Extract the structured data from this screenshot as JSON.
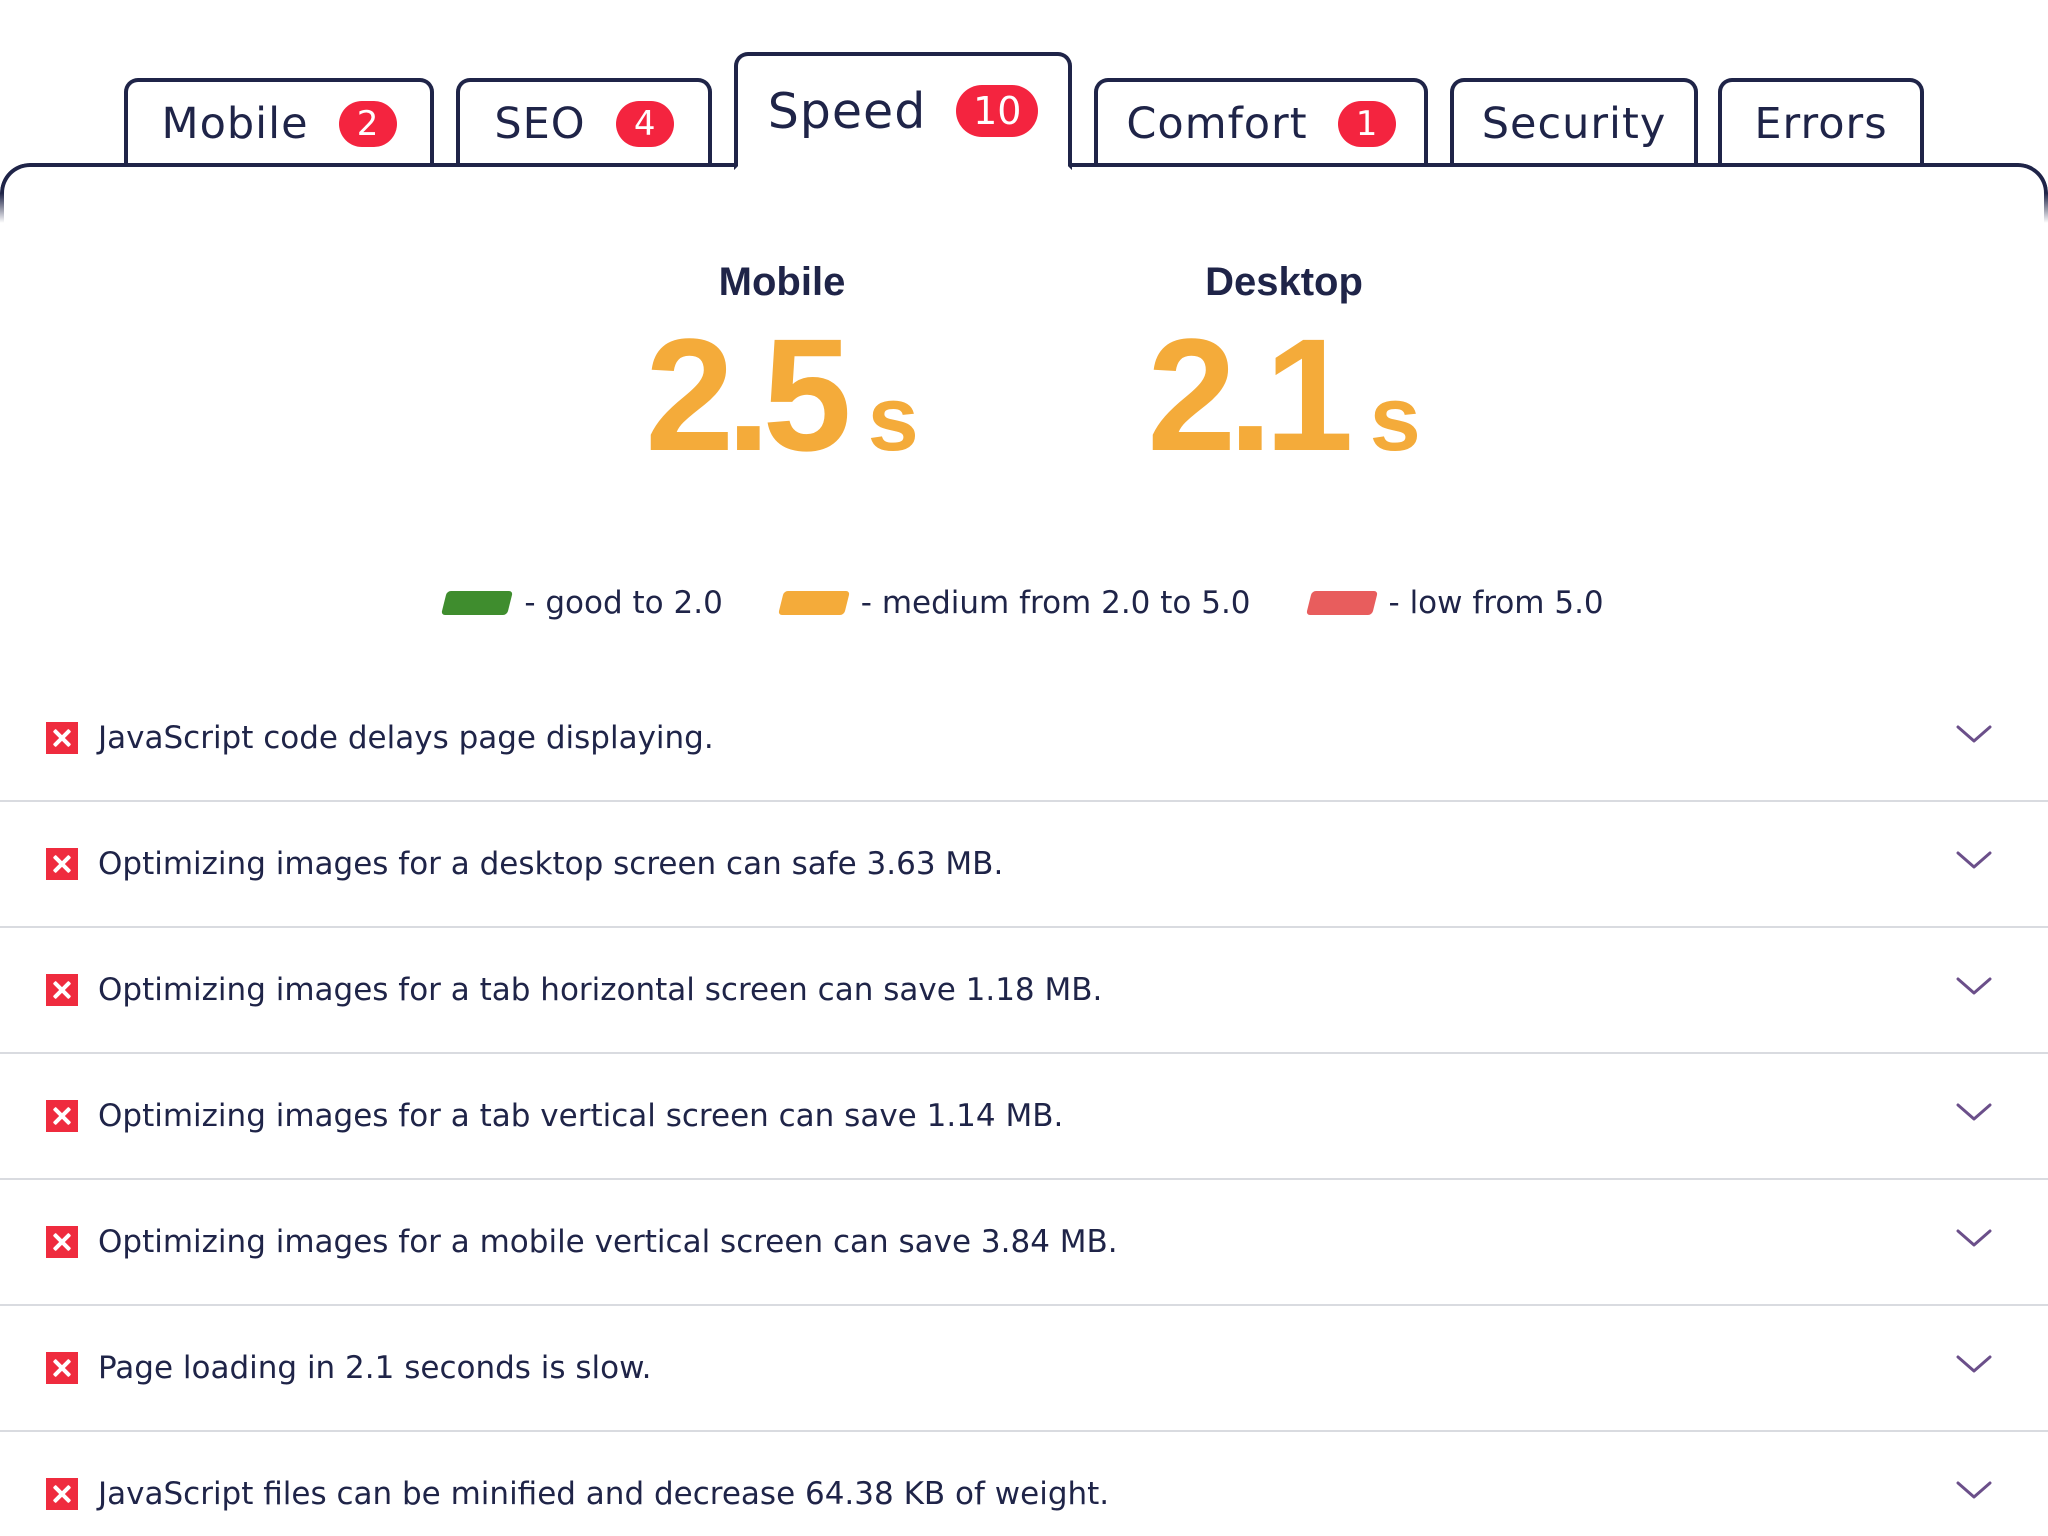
{
  "tabs": [
    {
      "label": "Mobile",
      "badge": "2",
      "active": false
    },
    {
      "label": "SEO",
      "badge": "4",
      "active": false
    },
    {
      "label": "Speed",
      "badge": "10",
      "active": true
    },
    {
      "label": "Comfort",
      "badge": "1",
      "active": false
    },
    {
      "label": "Security",
      "badge": "",
      "active": false
    },
    {
      "label": "Errors",
      "badge": "",
      "active": false
    }
  ],
  "scores": {
    "mobile": {
      "title": "Mobile",
      "value": "2.5",
      "unit": "s"
    },
    "desktop": {
      "title": "Desktop",
      "value": "2.1",
      "unit": "s"
    }
  },
  "legend": [
    {
      "text": "- good to 2.0",
      "color": "#3f8d2e"
    },
    {
      "text": "- medium from 2.0 to 5.0",
      "color": "#f4ab3a"
    },
    {
      "text": "- low from 5.0",
      "color": "#e85d5d"
    }
  ],
  "issues": [
    {
      "text": "JavaScript code delays page displaying.",
      "icon": "error-x-icon"
    },
    {
      "text": "Optimizing images for a desktop screen can safe 3.63 MB.",
      "icon": "error-x-icon"
    },
    {
      "text": "Optimizing images for a tab horizontal screen can save 1.18 MB.",
      "icon": "error-x-icon"
    },
    {
      "text": "Optimizing images for a tab vertical screen can save 1.14 MB.",
      "icon": "error-x-icon"
    },
    {
      "text": "Optimizing images for a mobile vertical screen can save 3.84 MB.",
      "icon": "error-x-icon"
    },
    {
      "text": "Page loading in 2.1 seconds is slow.",
      "icon": "error-x-icon"
    },
    {
      "text": "JavaScript files can be minified and decrease 64.38 KB of weight.",
      "icon": "error-x-icon"
    }
  ],
  "colors": {
    "text": "#1f2448",
    "badge": "#f4243f",
    "score": "#f4ab3a",
    "error_icon": "#ef2b3e",
    "chevron": "#6b4f8a"
  }
}
